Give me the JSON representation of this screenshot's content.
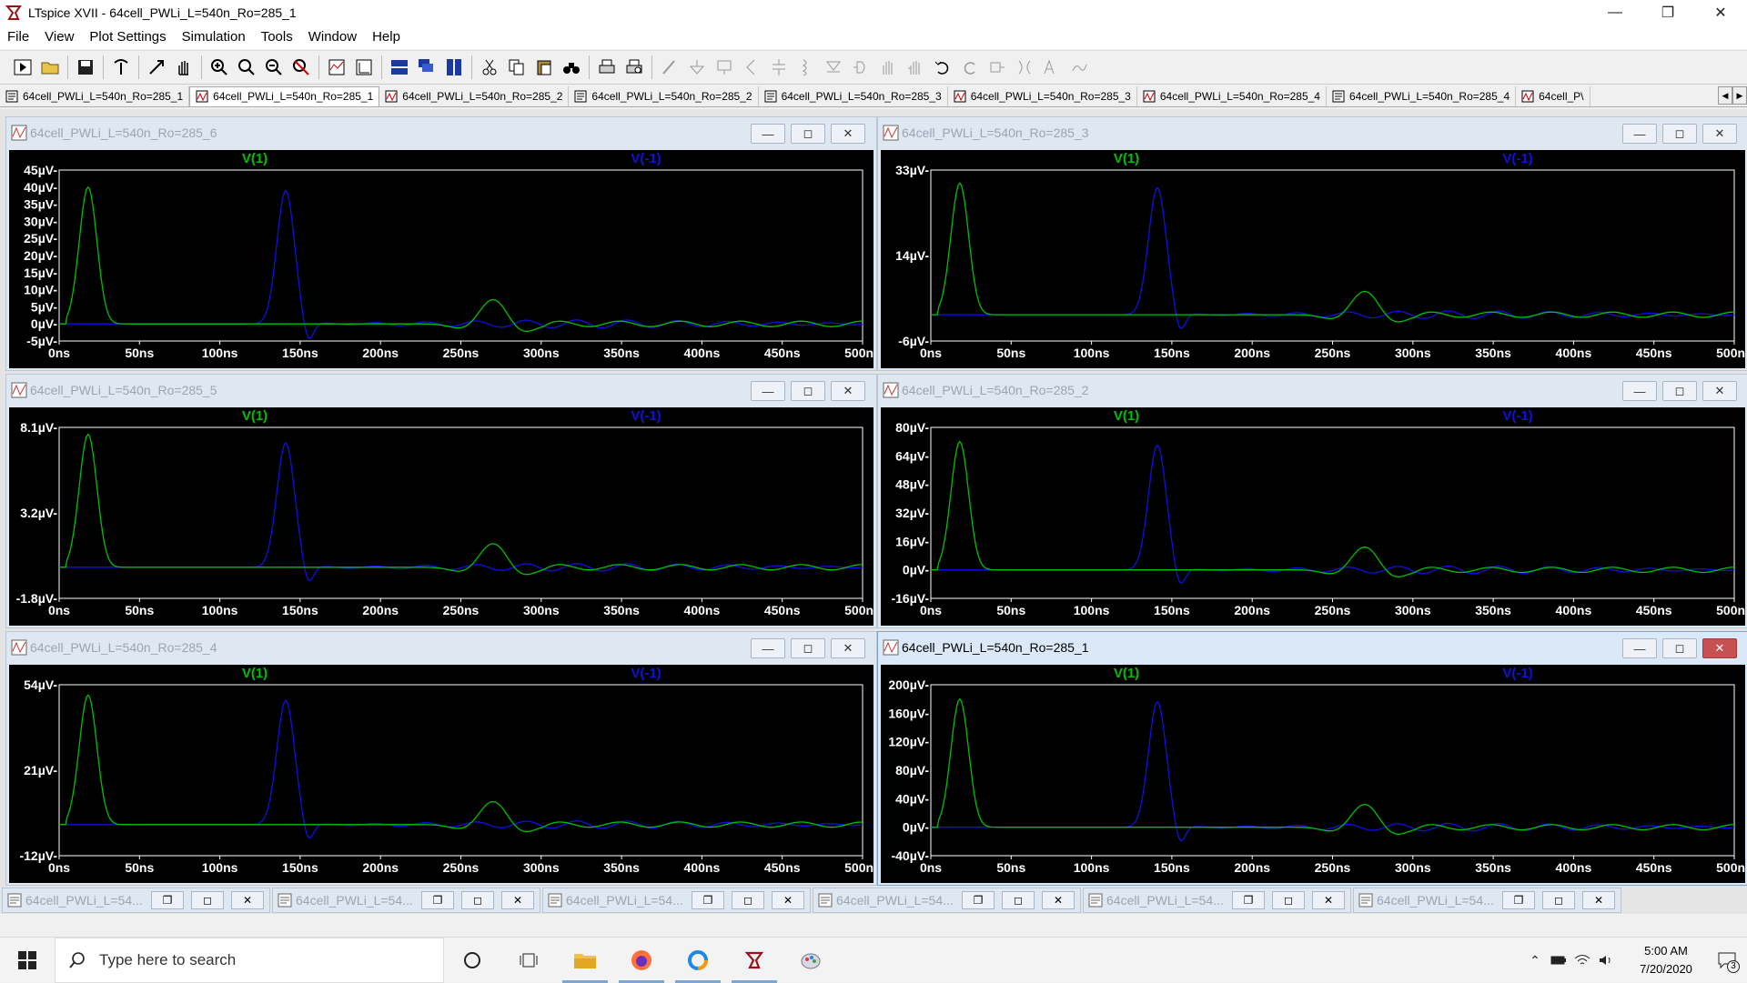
{
  "app": {
    "window_title": "LTspice XVII - 64cell_PWLi_L=540n_Ro=285_1"
  },
  "menu": [
    "File",
    "View",
    "Plot Settings",
    "Simulation",
    "Tools",
    "Window",
    "Help"
  ],
  "doc_tabs": [
    {
      "label": "64cell_PWLi_L=540n_Ro=285_1",
      "kind": "schematic",
      "active": false
    },
    {
      "label": "64cell_PWLi_L=540n_Ro=285_1",
      "kind": "waveform",
      "active": true
    },
    {
      "label": "64cell_PWLi_L=540n_Ro=285_2",
      "kind": "waveform",
      "active": false
    },
    {
      "label": "64cell_PWLi_L=540n_Ro=285_2",
      "kind": "schematic",
      "active": false
    },
    {
      "label": "64cell_PWLi_L=540n_Ro=285_3",
      "kind": "schematic",
      "active": false
    },
    {
      "label": "64cell_PWLi_L=540n_Ro=285_3",
      "kind": "waveform",
      "active": false
    },
    {
      "label": "64cell_PWLi_L=540n_Ro=285_4",
      "kind": "waveform",
      "active": false
    },
    {
      "label": "64cell_PWLi_L=540n_Ro=285_4",
      "kind": "schematic",
      "active": false
    },
    {
      "label": "64cell_P\\",
      "kind": "waveform",
      "active": false
    }
  ],
  "colors": {
    "v1": "#00c000",
    "vm1": "#1010e0",
    "plot_bg": "#000000",
    "axis_text": "#ffffff"
  },
  "plot_windows": [
    {
      "title": "64cell_PWLi_L=540n_Ro=285_6",
      "active": false,
      "trace1": "V(1)",
      "trace2": "V(-1)",
      "y_ticks": [
        "45µV-",
        "40µV-",
        "35µV-",
        "30µV-",
        "25µV-",
        "20µV-",
        "15µV-",
        "10µV-",
        "5µV-",
        "0µV-",
        "-5µV-"
      ],
      "x_ticks": [
        "0ns",
        "50ns",
        "100ns",
        "150ns",
        "200ns",
        "250ns",
        "300ns",
        "350ns",
        "400ns",
        "450ns",
        "500ns"
      ],
      "chart_data": {
        "type": "line",
        "x_unit": "ns",
        "xlim": [
          0,
          500
        ],
        "ylim": [
          -5,
          45
        ],
        "y_unit": "µV",
        "v1_peak": 40,
        "vm1_peak": 39
      }
    },
    {
      "title": "64cell_PWLi_L=540n_Ro=285_3",
      "active": false,
      "trace1": "V(1)",
      "trace2": "V(-1)",
      "y_ticks": [
        "33µV-",
        "14µV-",
        "-6µV-"
      ],
      "x_ticks": [
        "0ns",
        "50ns",
        "100ns",
        "150ns",
        "200ns",
        "250ns",
        "300ns",
        "350ns",
        "400ns",
        "450ns",
        "500ns"
      ],
      "chart_data": {
        "type": "line",
        "x_unit": "ns",
        "xlim": [
          0,
          500
        ],
        "ylim": [
          -6,
          33
        ],
        "y_unit": "µV",
        "v1_peak": 30,
        "vm1_peak": 29
      }
    },
    {
      "title": "64cell_PWLi_L=540n_Ro=285_5",
      "active": false,
      "trace1": "V(1)",
      "trace2": "V(-1)",
      "y_ticks": [
        "8.1µV-",
        "3.2µV-",
        "-1.8µV-"
      ],
      "x_ticks": [
        "0ns",
        "50ns",
        "100ns",
        "150ns",
        "200ns",
        "250ns",
        "300ns",
        "350ns",
        "400ns",
        "450ns",
        "500ns"
      ],
      "chart_data": {
        "type": "line",
        "x_unit": "ns",
        "xlim": [
          0,
          500
        ],
        "ylim": [
          -1.8,
          8.1
        ],
        "y_unit": "µV",
        "v1_peak": 7.7,
        "vm1_peak": 7.2
      }
    },
    {
      "title": "64cell_PWLi_L=540n_Ro=285_2",
      "active": false,
      "trace1": "V(1)",
      "trace2": "V(-1)",
      "y_ticks": [
        "80µV-",
        "64µV-",
        "48µV-",
        "32µV-",
        "16µV-",
        "0µV-",
        "-16µV-"
      ],
      "x_ticks": [
        "0ns",
        "50ns",
        "100ns",
        "150ns",
        "200ns",
        "250ns",
        "300ns",
        "350ns",
        "400ns",
        "450ns",
        "500ns"
      ],
      "chart_data": {
        "type": "line",
        "x_unit": "ns",
        "xlim": [
          0,
          500
        ],
        "ylim": [
          -16,
          80
        ],
        "y_unit": "µV",
        "v1_peak": 72,
        "vm1_peak": 70
      }
    },
    {
      "title": "64cell_PWLi_L=540n_Ro=285_4",
      "active": false,
      "trace1": "V(1)",
      "trace2": "V(-1)",
      "y_ticks": [
        "54µV-",
        "21µV-",
        "-12µV-"
      ],
      "x_ticks": [
        "0ns",
        "50ns",
        "100ns",
        "150ns",
        "200ns",
        "250ns",
        "300ns",
        "350ns",
        "400ns",
        "450ns",
        "500ns"
      ],
      "chart_data": {
        "type": "line",
        "x_unit": "ns",
        "xlim": [
          0,
          500
        ],
        "ylim": [
          -12,
          54
        ],
        "y_unit": "µV",
        "v1_peak": 50,
        "vm1_peak": 48
      }
    },
    {
      "title": "64cell_PWLi_L=540n_Ro=285_1",
      "active": true,
      "trace1": "V(1)",
      "trace2": "V(-1)",
      "y_ticks": [
        "200µV-",
        "160µV-",
        "120µV-",
        "80µV-",
        "40µV-",
        "0µV-",
        "-40µV-"
      ],
      "x_ticks": [
        "0ns",
        "50ns",
        "100ns",
        "150ns",
        "200ns",
        "250ns",
        "300ns",
        "350ns",
        "400ns",
        "450ns",
        "500ns"
      ],
      "chart_data": {
        "type": "line",
        "x_unit": "ns",
        "xlim": [
          0,
          500
        ],
        "ylim": [
          -40,
          200
        ],
        "y_unit": "µV",
        "v1_peak": 180,
        "vm1_peak": 176
      }
    }
  ],
  "minimized_windows": [
    "64cell_PWLi_L=54...",
    "64cell_PWLi_L=54...",
    "64cell_PWLi_L=54...",
    "64cell_PWLi_L=54...",
    "64cell_PWLi_L=54...",
    "64cell_PWLi_L=54..."
  ],
  "taskbar": {
    "search_placeholder": "Type here to search",
    "time": "5:00 AM",
    "date": "7/20/2020",
    "notification_count": "3"
  }
}
